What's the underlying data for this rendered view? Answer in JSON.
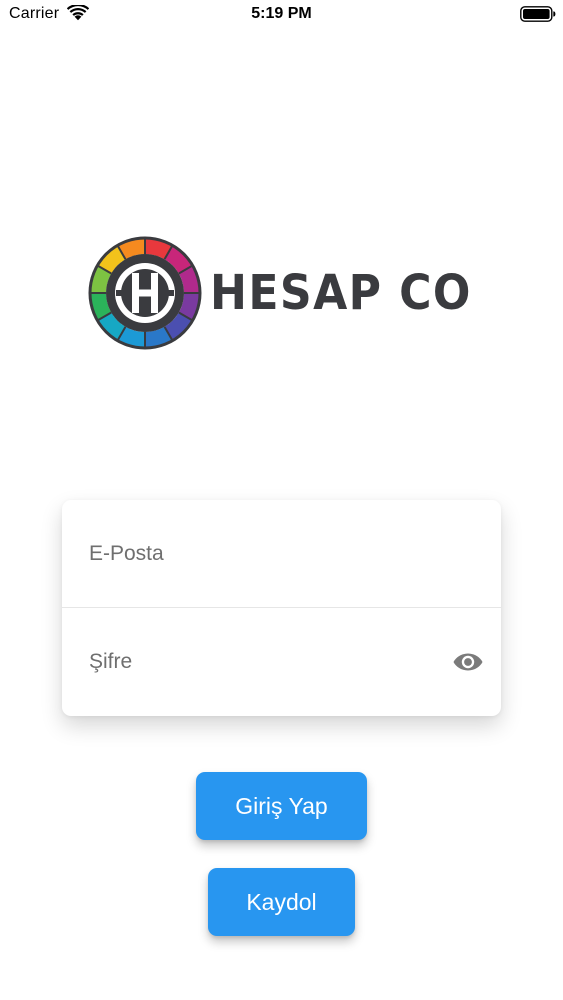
{
  "status_bar": {
    "carrier": "Carrier",
    "time": "5:19 PM",
    "wifi_icon": "wifi-icon",
    "battery_icon": "battery-full-icon"
  },
  "logo": {
    "text": "HESAP CO",
    "icon": "hesap-co-logo-mark",
    "text_color": "#3a3b3f"
  },
  "login_form": {
    "email_placeholder": "E-Posta",
    "email_value": "",
    "password_placeholder": "Şifre",
    "password_value": "",
    "password_visibility_icon": "eye-icon"
  },
  "buttons": {
    "login_label": "Giriş Yap",
    "register_label": "Kaydol"
  },
  "colors": {
    "accent": "#2896f0",
    "button_text": "#ffffff",
    "placeholder": "#6f6f6f",
    "eye_icon": "#7b7b7b"
  }
}
